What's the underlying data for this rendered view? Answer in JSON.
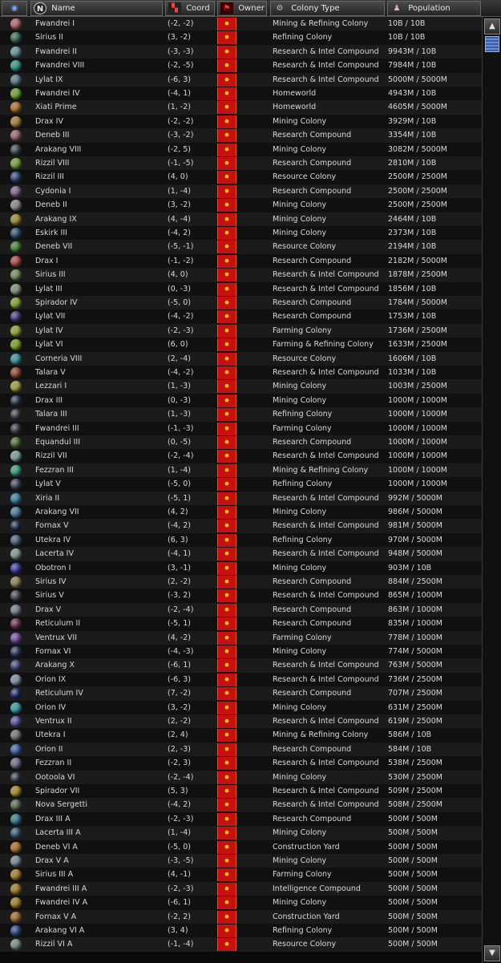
{
  "header": {
    "view_icon": "eye-icon",
    "name_icon": "N",
    "name_label": "Name",
    "coord_label": "Coord",
    "owner_label": "Owner",
    "type_label": "Colony Type",
    "pop_label": "Population",
    "coord_icon": "radar-icon",
    "owner_icon": "flag-icon",
    "type_icon": "gear-icon",
    "pop_icon": "person-icon"
  },
  "owner_emblem": "faction-emblem-icon",
  "owner_color": "#c81010",
  "scrollbar": {
    "up": "▲",
    "down": "▼"
  },
  "colonies": [
    {
      "name": "Fwandrei I",
      "coord": "(-2, -2)",
      "type": "Mining & Refining Colony",
      "pop": "10B / 10B",
      "color": "#e07a7a"
    },
    {
      "name": "Sirius II",
      "coord": "(3, -2)",
      "type": "Refining Colony",
      "pop": "10B / 10B",
      "color": "#4a8a6a"
    },
    {
      "name": "Fwandrei II",
      "coord": "(-3, -3)",
      "type": "Research & Intel Compound",
      "pop": "9943M / 10B",
      "color": "#7ab8c8"
    },
    {
      "name": "Fwandrei VIII",
      "coord": "(-2, -5)",
      "type": "Research & Intel Compound",
      "pop": "7984M / 10B",
      "color": "#3ac0b0"
    },
    {
      "name": "Lylat IX",
      "coord": "(-6, 3)",
      "type": "Research & Intel Compound",
      "pop": "5000M / 5000M",
      "color": "#6a9ab0"
    },
    {
      "name": "Fwandrei IV",
      "coord": "(-4, 1)",
      "type": "Homeworld",
      "pop": "4943M / 10B",
      "color": "#8ad040"
    },
    {
      "name": "Xiati Prime",
      "coord": "(1, -2)",
      "type": "Homeworld",
      "pop": "4605M / 5000M",
      "color": "#e08a30"
    },
    {
      "name": "Drax IV",
      "coord": "(-2, -2)",
      "type": "Mining Colony",
      "pop": "3929M / 10B",
      "color": "#d8a040"
    },
    {
      "name": "Deneb III",
      "coord": "(-3, -2)",
      "type": "Research Compound",
      "pop": "3354M / 10B",
      "color": "#c07a8a"
    },
    {
      "name": "Arakang VIII",
      "coord": "(-2, 5)",
      "type": "Mining Colony",
      "pop": "3082M / 5000M",
      "color": "#4a5a6a"
    },
    {
      "name": "Rizzil VIII",
      "coord": "(-1, -5)",
      "type": "Research Compound",
      "pop": "2810M / 10B",
      "color": "#8ad040"
    },
    {
      "name": "Rizzil III",
      "coord": "(4, 0)",
      "type": "Resource Colony",
      "pop": "2500M / 2500M",
      "color": "#3a5aa0"
    },
    {
      "name": "Cydonia I",
      "coord": "(1, -4)",
      "type": "Research Compound",
      "pop": "2500M / 2500M",
      "color": "#a07ab0"
    },
    {
      "name": "Deneb II",
      "coord": "(3, -2)",
      "type": "Mining Colony",
      "pop": "2500M / 2500M",
      "color": "#b0b0b0"
    },
    {
      "name": "Arakang IX",
      "coord": "(4, -4)",
      "type": "Mining Colony",
      "pop": "2464M / 10B",
      "color": "#c8b030"
    },
    {
      "name": "Eskirk III",
      "coord": "(-4, 2)",
      "type": "Mining Colony",
      "pop": "2373M / 10B",
      "color": "#3a6a8a"
    },
    {
      "name": "Deneb VII",
      "coord": "(-5, -1)",
      "type": "Resource Colony",
      "pop": "2194M / 10B",
      "color": "#5aa040"
    },
    {
      "name": "Drax I",
      "coord": "(-1, -2)",
      "type": "Research Compound",
      "pop": "2182M / 5000M",
      "color": "#d85a5a"
    },
    {
      "name": "Sirius III",
      "coord": "(4, 0)",
      "type": "Research & Intel Compound",
      "pop": "1878M / 2500M",
      "color": "#8ab070"
    },
    {
      "name": "Lylat III",
      "coord": "(0, -3)",
      "type": "Research & Intel Compound",
      "pop": "1856M / 10B",
      "color": "#a0b890"
    },
    {
      "name": "Spirador IV",
      "coord": "(-5, 0)",
      "type": "Research Compound",
      "pop": "1784M / 5000M",
      "color": "#a0d030"
    },
    {
      "name": "Lylat VII",
      "coord": "(-4, -2)",
      "type": "Research Compound",
      "pop": "1753M / 10B",
      "color": "#5a4aa0"
    },
    {
      "name": "Lylat IV",
      "coord": "(-2, -3)",
      "type": "Farming Colony",
      "pop": "1736M / 2500M",
      "color": "#b0d040"
    },
    {
      "name": "Lylat VI",
      "coord": "(6, 0)",
      "type": "Farming & Refining Colony",
      "pop": "1633M / 2500M",
      "color": "#98d020"
    },
    {
      "name": "Corneria VIII",
      "coord": "(2, -4)",
      "type": "Resource Colony",
      "pop": "1606M / 10B",
      "color": "#40b8c0"
    },
    {
      "name": "Talara V",
      "coord": "(-4, -2)",
      "type": "Research & Intel Compound",
      "pop": "1033M / 10B",
      "color": "#b85a3a"
    },
    {
      "name": "Lezzari I",
      "coord": "(1, -3)",
      "type": "Mining Colony",
      "pop": "1003M / 2500M",
      "color": "#c8c840"
    },
    {
      "name": "Drax III",
      "coord": "(0, -3)",
      "type": "Mining Colony",
      "pop": "1000M / 1000M",
      "color": "#3a4a6a"
    },
    {
      "name": "Talara III",
      "coord": "(1, -3)",
      "type": "Refining Colony",
      "pop": "1000M / 1000M",
      "color": "#4a5060"
    },
    {
      "name": "Fwandrei III",
      "coord": "(-1, -3)",
      "type": "Farming Colony",
      "pop": "1000M / 1000M",
      "color": "#4a4a5a"
    },
    {
      "name": "Equandul III",
      "coord": "(0, -5)",
      "type": "Research Compound",
      "pop": "1000M / 1000M",
      "color": "#5a8a3a"
    },
    {
      "name": "Rizzil VII",
      "coord": "(-2, -4)",
      "type": "Research & Intel Compound",
      "pop": "1000M / 1000M",
      "color": "#a0c8d0"
    },
    {
      "name": "Fezzran III",
      "coord": "(1, -4)",
      "type": "Mining & Refining Colony",
      "pop": "1000M / 1000M",
      "color": "#40c8a0"
    },
    {
      "name": "Lylat V",
      "coord": "(-5, 0)",
      "type": "Refining Colony",
      "pop": "1000M / 1000M",
      "color": "#4a5a7a"
    },
    {
      "name": "Xiria II",
      "coord": "(-5, 1)",
      "type": "Research & Intel Compound",
      "pop": "992M / 5000M",
      "color": "#3aa0c8"
    },
    {
      "name": "Arakang VII",
      "coord": "(4, 2)",
      "type": "Mining Colony",
      "pop": "986M / 5000M",
      "color": "#5a9ac8"
    },
    {
      "name": "Fornax V",
      "coord": "(-4, 2)",
      "type": "Research & Intel Compound",
      "pop": "981M / 5000M",
      "color": "#2a3a6a"
    },
    {
      "name": "Utekra IV",
      "coord": "(6, 3)",
      "type": "Refining Colony",
      "pop": "970M / 5000M",
      "color": "#5a7aa0"
    },
    {
      "name": "Lacerta IV",
      "coord": "(-4, 1)",
      "type": "Research & Intel Compound",
      "pop": "948M / 5000M",
      "color": "#a0c0b0"
    },
    {
      "name": "Obotron I",
      "coord": "(3, -1)",
      "type": "Mining Colony",
      "pop": "903M / 10B",
      "color": "#4a4ad0"
    },
    {
      "name": "Sirius IV",
      "coord": "(2, -2)",
      "type": "Research Compound",
      "pop": "884M / 2500M",
      "color": "#b0a060"
    },
    {
      "name": "Sirius V",
      "coord": "(-3, 2)",
      "type": "Research & Intel Compound",
      "pop": "865M / 1000M",
      "color": "#5a5a6a"
    },
    {
      "name": "Drax V",
      "coord": "(-2, -4)",
      "type": "Research Compound",
      "pop": "863M / 1000M",
      "color": "#8a9ab0"
    },
    {
      "name": "Reticulum II",
      "coord": "(-5, 1)",
      "type": "Research Compound",
      "pop": "835M / 1000M",
      "color": "#8a3a6a"
    },
    {
      "name": "Ventrux VII",
      "coord": "(4, -2)",
      "type": "Farming Colony",
      "pop": "778M / 1000M",
      "color": "#9a5ad0"
    },
    {
      "name": "Fornax VI",
      "coord": "(-4, -3)",
      "type": "Mining Colony",
      "pop": "774M / 5000M",
      "color": "#3a4a7a"
    },
    {
      "name": "Arakang X",
      "coord": "(-6, 1)",
      "type": "Research & Intel Compound",
      "pop": "763M / 5000M",
      "color": "#4a5aa0"
    },
    {
      "name": "Orion IX",
      "coord": "(-6, 3)",
      "type": "Research & Intel Compound",
      "pop": "736M / 2500M",
      "color": "#a0b8d0"
    },
    {
      "name": "Reticulum IV",
      "coord": "(7, -2)",
      "type": "Research Compound",
      "pop": "707M / 2500M",
      "color": "#2a3a8a"
    },
    {
      "name": "Orion IV",
      "coord": "(3, -2)",
      "type": "Mining Colony",
      "pop": "631M / 2500M",
      "color": "#3ac8d0"
    },
    {
      "name": "Ventrux II",
      "coord": "(2, -2)",
      "type": "Research & Intel Compound",
      "pop": "619M / 2500M",
      "color": "#6a6ac8"
    },
    {
      "name": "Utekra I",
      "coord": "(2, 4)",
      "type": "Mining & Refining Colony",
      "pop": "586M / 10B",
      "color": "#909090"
    },
    {
      "name": "Orion II",
      "coord": "(2, -3)",
      "type": "Research Compound",
      "pop": "584M / 10B",
      "color": "#4a7ad8"
    },
    {
      "name": "Fezzran II",
      "coord": "(-2, 3)",
      "type": "Research & Intel Compound",
      "pop": "538M / 2500M",
      "color": "#8a8ab0"
    },
    {
      "name": "Ootoola VI",
      "coord": "(-2, -4)",
      "type": "Mining Colony",
      "pop": "530M / 2500M",
      "color": "#3a4a60"
    },
    {
      "name": "Spirador VII",
      "coord": "(5, 3)",
      "type": "Research & Intel Compound",
      "pop": "509M / 2500M",
      "color": "#d0b030"
    },
    {
      "name": "Nova Sergetti",
      "coord": "(-4, 2)",
      "type": "Research & Intel Compound",
      "pop": "508M / 2500M",
      "color": "#6a8a60"
    },
    {
      "name": "Drax III A",
      "coord": "(-2, -3)",
      "type": "Research Compound",
      "pop": "500M / 500M",
      "color": "#40a0b0"
    },
    {
      "name": "Lacerta III A",
      "coord": "(1, -4)",
      "type": "Mining Colony",
      "pop": "500M / 500M",
      "color": "#4a6a8a"
    },
    {
      "name": "Deneb VI A",
      "coord": "(-5, 0)",
      "type": "Construction Yard",
      "pop": "500M / 500M",
      "color": "#e08a30"
    },
    {
      "name": "Drax V A",
      "coord": "(-3, -5)",
      "type": "Mining Colony",
      "pop": "500M / 500M",
      "color": "#90b0b8"
    },
    {
      "name": "Sirius III A",
      "coord": "(4, -1)",
      "type": "Farming Colony",
      "pop": "500M / 500M",
      "color": "#d0a030"
    },
    {
      "name": "Fwandrei III A",
      "coord": "(-2, -3)",
      "type": "Intelligence Compound",
      "pop": "500M / 500M",
      "color": "#c89a30"
    },
    {
      "name": "Fwandrei IV A",
      "coord": "(-6, 1)",
      "type": "Mining Colony",
      "pop": "500M / 500M",
      "color": "#c8a030"
    },
    {
      "name": "Fornax V A",
      "coord": "(-2, 2)",
      "type": "Construction Yard",
      "pop": "500M / 500M",
      "color": "#d08030"
    },
    {
      "name": "Arakang VI A",
      "coord": "(3, 4)",
      "type": "Refining Colony",
      "pop": "500M / 500M",
      "color": "#3a5ab0"
    },
    {
      "name": "Rizzil VI A",
      "coord": "(-1, -4)",
      "type": "Resource Colony",
      "pop": "500M / 500M",
      "color": "#90b0a0"
    }
  ]
}
